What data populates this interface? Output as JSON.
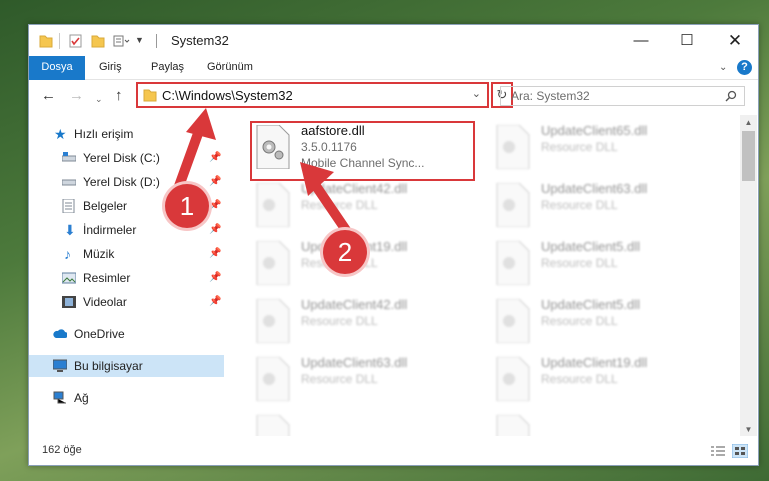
{
  "window": {
    "title": "System32"
  },
  "ribbon": {
    "tabs": [
      {
        "label": "Dosya"
      },
      {
        "label": "Giriş"
      },
      {
        "label": "Paylaş"
      },
      {
        "label": "Görünüm"
      }
    ]
  },
  "address": {
    "path": "C:\\Windows\\System32"
  },
  "search": {
    "placeholder": "Ara: System32"
  },
  "sidebar": {
    "items": [
      {
        "label": "Hızlı erişim"
      },
      {
        "label": "Yerel Disk (C:)"
      },
      {
        "label": "Yerel Disk (D:)"
      },
      {
        "label": "Belgeler"
      },
      {
        "label": "İndirmeler"
      },
      {
        "label": "Müzik"
      },
      {
        "label": "Resimler"
      },
      {
        "label": "Videolar"
      },
      {
        "label": "OneDrive"
      },
      {
        "label": "Bu bilgisayar"
      },
      {
        "label": "Ağ"
      }
    ]
  },
  "files": {
    "highlighted": {
      "name": "aafstore.dll",
      "version": "3.5.0.1176",
      "description": "Mobile Channel Sync..."
    },
    "blurred": [
      {
        "name": "UpdateClient65.dll",
        "description": "Resource DLL"
      },
      {
        "name": "UpdateClient42.dll",
        "description": "Resource DLL"
      },
      {
        "name": "UpdateClient63.dll",
        "description": "Resource DLL"
      },
      {
        "name": "UpdateClient19.dll",
        "description": "Resource DLL"
      },
      {
        "name": "UpdateClient5.dll",
        "description": "Resource DLL"
      },
      {
        "name": "UpdateClient42.dll",
        "description": "Resource DLL"
      },
      {
        "name": "UpdateClient5.dll",
        "description": "Resource DLL"
      },
      {
        "name": "UpdateClient63.dll",
        "description": "Resource DLL"
      },
      {
        "name": "UpdateClient19.dll",
        "description": "Resource DLL"
      }
    ]
  },
  "status": {
    "count": "162 öğe"
  },
  "callouts": {
    "one": "1",
    "two": "2"
  },
  "colors": {
    "accent": "#1979ca",
    "highlight": "#d9383a"
  }
}
